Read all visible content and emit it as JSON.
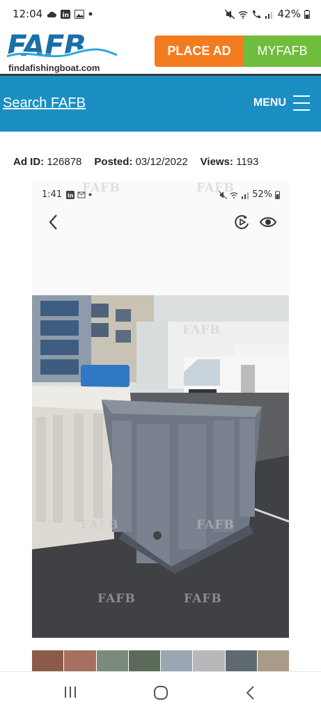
{
  "status_bar": {
    "time": "12:04",
    "battery": "42%",
    "left_icons": [
      "cloud-icon",
      "linkedin-icon",
      "gallery-icon",
      "dot-icon"
    ],
    "right_icons": [
      "mute-icon",
      "wifi-icon",
      "wifi-call-icon",
      "signal-icon",
      "battery-icon"
    ]
  },
  "header": {
    "logo_text": "FAFB",
    "logo_url": "findafishingboat.com",
    "place_ad_label": "PLACE AD",
    "myfafb_label": "MYFAFB",
    "colors": {
      "place_ad": "#f47c20",
      "myfafb": "#6fbd3c",
      "brand_blue": "#1a6fa8"
    }
  },
  "navbar": {
    "search_label": "Search FAFB",
    "menu_label": "MENU",
    "background": "#1b8fc4"
  },
  "ad_meta": {
    "ad_id_label": "Ad ID:",
    "ad_id_value": "126878",
    "posted_label": "Posted:",
    "posted_value": "03/12/2022",
    "views_label": "Views:",
    "views_value": "1193"
  },
  "ad_image": {
    "inner_time": "1:41",
    "inner_battery": "52%",
    "watermark": "FAFB"
  },
  "thumbnails": {
    "count": 8,
    "colors": [
      "#8c5a4a",
      "#a67060",
      "#7a8a7c",
      "#5c6a5a",
      "#9aa6b4",
      "#b8b8ba",
      "#5e6a6e",
      "#aa9a88"
    ]
  },
  "android_nav": {
    "icons": [
      "recent-apps-icon",
      "home-icon",
      "back-icon"
    ]
  }
}
